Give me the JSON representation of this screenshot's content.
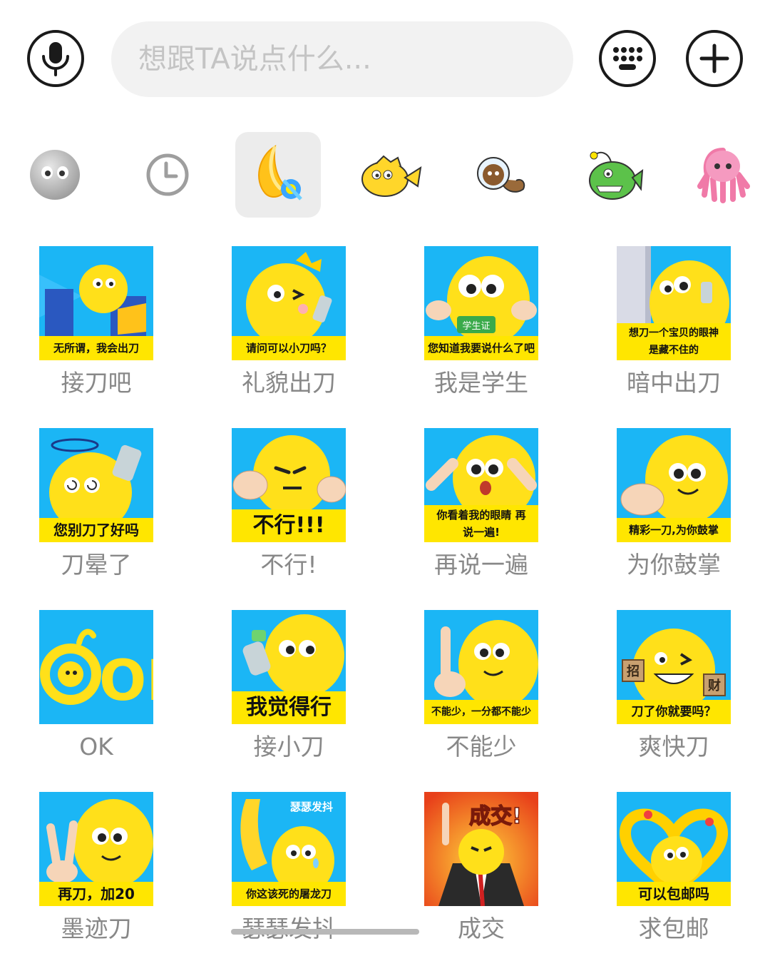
{
  "input_bar": {
    "placeholder": "想跟TA说点什么..."
  },
  "icons": {
    "voice": "microphone-icon",
    "keyboard": "keyboard-icon",
    "more": "plus-icon"
  },
  "tabs": [
    {
      "name": "emoji-face-icon"
    },
    {
      "name": "recent-clock-icon"
    },
    {
      "name": "knife-sticker-pack-icon",
      "active": true
    },
    {
      "name": "yellow-fish-pack-icon"
    },
    {
      "name": "astronaut-worm-pack-icon"
    },
    {
      "name": "green-anglerfish-pack-icon"
    },
    {
      "name": "pink-octopus-pack-icon"
    }
  ],
  "stickers": [
    {
      "label": "接刀吧",
      "caption": "无所谓，我会出刀"
    },
    {
      "label": "礼貌出刀",
      "caption": "请问可以小刀吗？"
    },
    {
      "label": "我是学生",
      "caption": "您知道我要说什么了吧"
    },
    {
      "label": "暗中出刀",
      "caption": "想刀一个宝贝的眼神 是藏不住的"
    },
    {
      "label": "刀晕了",
      "caption": "您别刀了好吗"
    },
    {
      "label": "不行!",
      "caption": "不行!!!"
    },
    {
      "label": "再说一遍",
      "caption": "你看着我的眼睛 再说一遍!"
    },
    {
      "label": "为你鼓掌",
      "caption": "精彩一刀,为你鼓掌"
    },
    {
      "label": "OK",
      "caption": ""
    },
    {
      "label": "接小刀",
      "caption": "我觉得行"
    },
    {
      "label": "不能少",
      "caption": "不能少，一分都不能少"
    },
    {
      "label": "爽快刀",
      "caption": "刀了你就要吗？"
    },
    {
      "label": "墨迹刀",
      "caption": "再刀，加20"
    },
    {
      "label": "瑟瑟发抖",
      "caption": "你这该死的屠龙刀"
    },
    {
      "label": "成交",
      "caption": "成交!"
    },
    {
      "label": "求包邮",
      "caption": "可以包邮吗"
    }
  ],
  "sticker_extra_text": {
    "student_card": "学生证",
    "shiver": "瑟瑟发抖",
    "ok_big": "OK",
    "zhao": "招",
    "cai": "财"
  }
}
